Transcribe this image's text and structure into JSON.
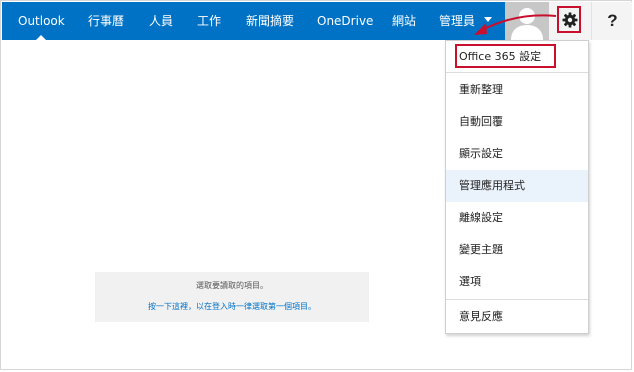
{
  "nav": {
    "items": [
      "Outlook",
      "行事曆",
      "人員",
      "工作",
      "新聞摘要",
      "OneDrive",
      "網站",
      "管理員"
    ],
    "active_index": 0
  },
  "toolbar": {
    "settings_icon": "gear-icon",
    "help_label": "?"
  },
  "settings_menu": {
    "items": [
      "Office 365 設定",
      "重新整理",
      "自動回覆",
      "顯示設定",
      "管理應用程式",
      "離線設定",
      "變更主題",
      "選項",
      "意見反應"
    ],
    "highlighted_index": 4
  },
  "reading_pane": {
    "message": "選取要讀取的項目。",
    "link_text": "按一下這裡，以在登入時一律選取第一個項目。"
  },
  "colors": {
    "top_bar": "#0072c6",
    "annotation": "#c8102e",
    "menu_hover": "#eaf2fb"
  }
}
